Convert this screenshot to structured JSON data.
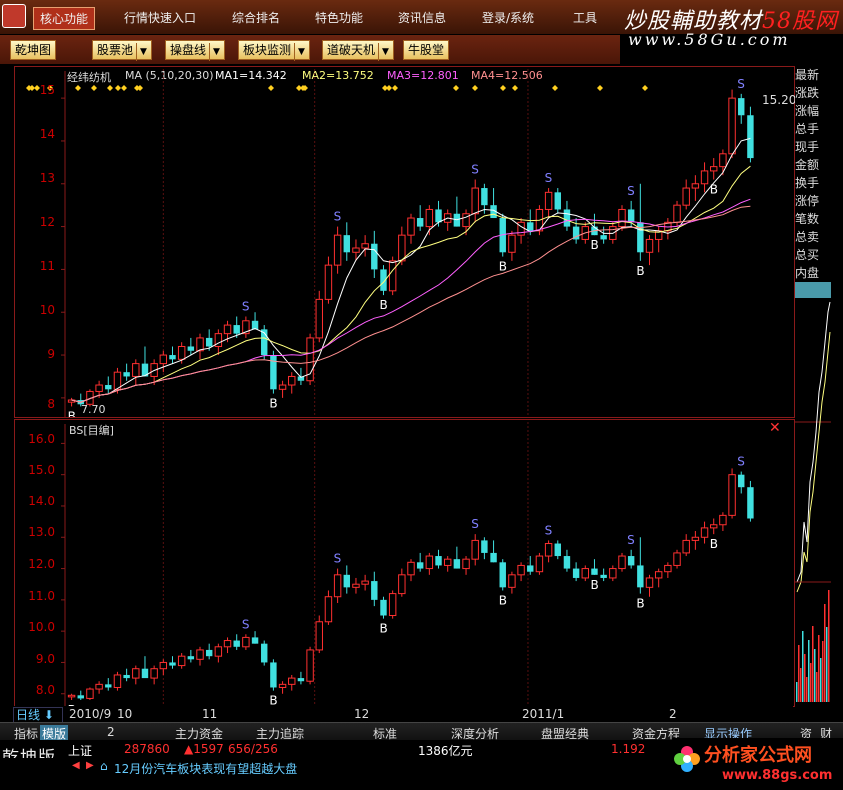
{
  "menubar": {
    "items": [
      "核心功能",
      "行情快速入口",
      "综合排名",
      "特色功能",
      "资讯信息",
      "登录/系统",
      "工具"
    ],
    "active_index": 0
  },
  "watermark_top": {
    "title_white": "炒股輔助教材",
    "title_red": "58股网",
    "url": "www.58Gu.com"
  },
  "toolbar": {
    "buttons": [
      {
        "label": "乾坤图",
        "dropdown": false
      },
      {
        "label": "股票池",
        "dropdown": true
      },
      {
        "label": "操盘线",
        "dropdown": true
      },
      {
        "label": "板块监测",
        "dropdown": true
      },
      {
        "label": "道破天机",
        "dropdown": true
      },
      {
        "label": "牛股堂",
        "dropdown": false
      }
    ]
  },
  "top_pane": {
    "stock_name": "经纬纺机",
    "ma_label": "MA (5,10,20,30)",
    "ma1": "MA1=14.342",
    "ma2": "MA2=13.752",
    "ma3": "MA3=12.801",
    "ma4": "MA4=12.506",
    "ma_colors": {
      "ma1": "#ffffff",
      "ma2": "#ffff80",
      "ma3": "#ff60ff",
      "ma4": "#ff9090"
    },
    "yaxis": [
      "15",
      "14",
      "13",
      "12",
      "11",
      "10",
      "9",
      "8"
    ],
    "high_label": "15.20",
    "low_label": "7.70"
  },
  "bottom_pane": {
    "title": "BS[目编]",
    "yaxis": [
      "16.0",
      "15.0",
      "14.0",
      "13.0",
      "12.0",
      "11.0",
      "10.0",
      "9.0",
      "8.0"
    ]
  },
  "sidebar": {
    "items": [
      "最新",
      "涨跌",
      "涨幅",
      "总手",
      "现手",
      "金额",
      "换手",
      "涨停",
      "笔数",
      "总卖",
      "总买",
      "内盘"
    ]
  },
  "date_axis": {
    "period": "日线",
    "labels": [
      "2010/9",
      "10",
      "11",
      "12",
      "2011/1",
      "2"
    ]
  },
  "tabbar": {
    "items": [
      "指标",
      "模版",
      "2",
      "主力资金",
      "主力追踪",
      "标准",
      "深度分析",
      "盘盟经典",
      "资金方程",
      "显示操作",
      "资",
      "财"
    ],
    "active_index": 1
  },
  "status": {
    "edition": "乾坤版",
    "index_name": "上证",
    "volume": "287860",
    "change": "▲1597",
    "updown": "656/256",
    "amount": "1386亿元",
    "ratio": "1.192",
    "news": "12月份汽车板块表现有望超越大盘"
  },
  "watermark_bottom": {
    "title": "分析家公式网",
    "url": "www.88gs.com"
  },
  "colors": {
    "up": "#ff3030",
    "down": "#40e0e0",
    "grid": "#8a1a1a",
    "buy": "#ffffff",
    "sell": "#8080ff"
  },
  "chart_data": {
    "type": "candlestick",
    "title": "经纬纺机",
    "ylim": [
      7.6,
      15.4
    ],
    "x_ticks": [
      "2010/9",
      "10",
      "11",
      "12",
      "2011/1",
      "2"
    ],
    "series": [
      {
        "values": [
          [
            7.9,
            8.0,
            7.8,
            7.95
          ],
          [
            7.95,
            8.1,
            7.8,
            7.85
          ],
          [
            7.85,
            8.2,
            7.8,
            8.15
          ],
          [
            8.15,
            8.4,
            8.0,
            8.3
          ],
          [
            8.3,
            8.5,
            8.1,
            8.2
          ],
          [
            8.2,
            8.7,
            8.1,
            8.6
          ],
          [
            8.6,
            8.8,
            8.4,
            8.5
          ],
          [
            8.5,
            8.9,
            8.3,
            8.8
          ],
          [
            8.8,
            9.2,
            8.6,
            8.5
          ],
          [
            8.5,
            8.9,
            8.3,
            8.8
          ],
          [
            8.8,
            9.1,
            8.6,
            9.0
          ],
          [
            9.0,
            9.2,
            8.8,
            8.9
          ],
          [
            8.9,
            9.3,
            8.8,
            9.2
          ],
          [
            9.2,
            9.4,
            9.0,
            9.1
          ],
          [
            9.1,
            9.5,
            8.9,
            9.4
          ],
          [
            9.4,
            9.6,
            9.1,
            9.2
          ],
          [
            9.2,
            9.6,
            9.0,
            9.5
          ],
          [
            9.5,
            9.8,
            9.3,
            9.7
          ],
          [
            9.7,
            9.9,
            9.4,
            9.5
          ],
          [
            9.5,
            9.9,
            9.4,
            9.8
          ],
          [
            9.8,
            10.0,
            9.6,
            9.6
          ],
          [
            9.6,
            9.7,
            8.9,
            9.0
          ],
          [
            9.0,
            9.1,
            8.1,
            8.2
          ],
          [
            8.2,
            8.4,
            8.0,
            8.3
          ],
          [
            8.3,
            8.6,
            8.1,
            8.5
          ],
          [
            8.5,
            8.7,
            8.3,
            8.4
          ],
          [
            8.4,
            9.5,
            8.3,
            9.4
          ],
          [
            9.4,
            10.5,
            9.3,
            10.3
          ],
          [
            10.3,
            11.3,
            10.2,
            11.1
          ],
          [
            11.1,
            12.0,
            10.9,
            11.8
          ],
          [
            11.8,
            12.1,
            11.2,
            11.4
          ],
          [
            11.4,
            11.7,
            11.2,
            11.5
          ],
          [
            11.5,
            11.8,
            11.3,
            11.6
          ],
          [
            11.6,
            11.9,
            10.8,
            11.0
          ],
          [
            11.0,
            11.1,
            10.4,
            10.5
          ],
          [
            10.5,
            11.3,
            10.4,
            11.2
          ],
          [
            11.2,
            12.0,
            11.1,
            11.8
          ],
          [
            11.8,
            12.3,
            11.6,
            12.2
          ],
          [
            12.2,
            12.5,
            11.9,
            12.0
          ],
          [
            12.0,
            12.5,
            11.8,
            12.4
          ],
          [
            12.4,
            12.6,
            12.0,
            12.1
          ],
          [
            12.1,
            12.4,
            11.9,
            12.3
          ],
          [
            12.3,
            12.7,
            12.0,
            12.0
          ],
          [
            12.0,
            12.4,
            11.8,
            12.3
          ],
          [
            12.3,
            13.1,
            12.1,
            12.9
          ],
          [
            12.9,
            13.0,
            12.3,
            12.5
          ],
          [
            12.5,
            12.9,
            12.2,
            12.2
          ],
          [
            12.2,
            12.3,
            11.3,
            11.4
          ],
          [
            11.4,
            11.9,
            11.2,
            11.8
          ],
          [
            11.8,
            12.2,
            11.6,
            12.1
          ],
          [
            12.1,
            12.4,
            11.8,
            11.9
          ],
          [
            11.9,
            12.5,
            11.8,
            12.4
          ],
          [
            12.4,
            12.9,
            12.2,
            12.8
          ],
          [
            12.8,
            12.9,
            12.3,
            12.4
          ],
          [
            12.4,
            12.6,
            11.9,
            12.0
          ],
          [
            12.0,
            12.2,
            11.6,
            11.7
          ],
          [
            11.7,
            12.1,
            11.6,
            12.0
          ],
          [
            12.0,
            12.3,
            11.8,
            11.8
          ],
          [
            11.8,
            12.0,
            11.6,
            11.7
          ],
          [
            11.7,
            12.1,
            11.6,
            12.0
          ],
          [
            12.0,
            12.5,
            11.9,
            12.4
          ],
          [
            12.4,
            12.6,
            12.0,
            12.1
          ],
          [
            12.1,
            13.0,
            11.2,
            11.4
          ],
          [
            11.4,
            11.8,
            11.1,
            11.7
          ],
          [
            11.7,
            12.0,
            11.4,
            11.9
          ],
          [
            11.9,
            12.2,
            11.7,
            12.1
          ],
          [
            12.1,
            12.6,
            12.0,
            12.5
          ],
          [
            12.5,
            13.1,
            12.4,
            12.9
          ],
          [
            12.9,
            13.2,
            12.6,
            13.0
          ],
          [
            13.0,
            13.5,
            12.8,
            13.3
          ],
          [
            13.3,
            13.6,
            13.1,
            13.4
          ],
          [
            13.4,
            13.8,
            13.2,
            13.7
          ],
          [
            13.7,
            15.2,
            13.6,
            15.0
          ],
          [
            15.0,
            15.1,
            14.4,
            14.6
          ],
          [
            14.6,
            14.8,
            13.5,
            13.6
          ]
        ]
      }
    ]
  }
}
